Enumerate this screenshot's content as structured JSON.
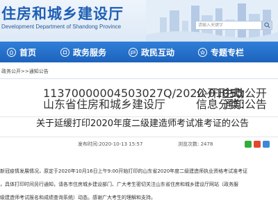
{
  "header": {
    "title_cn": "住房和城乡建设厅",
    "title_en": "Development Department of Shandong Province",
    "search_placeholder": "请输入关键字"
  },
  "nav": [
    {
      "label": "首页",
      "icon": "home-icon"
    },
    {
      "label": "政务服务",
      "icon": "service-icon"
    },
    {
      "label": "政民互动",
      "icon": "interaction-icon"
    },
    {
      "label": "专题专栏",
      "icon": "topic-icon"
    }
  ],
  "breadcrumb": "政务公开>>通知公告",
  "info": {
    "row1": {
      "value1": "11370000004503027Q/2020-01055",
      "label2": "公开形式:",
      "value2": "主动公开"
    },
    "row2": {
      "value1": "山东省住房和城乡建设厅",
      "label2": "信息分类:",
      "value2": "通知公告"
    }
  },
  "article": {
    "title": "关于延缓打印2020年度二级建造师考试准考证的公告",
    "date_line": "发布时间:2020-10-13 15:57",
    "views_label": "浏览次数:",
    "views": "2478",
    "paragraphs": [
      "新冠疫情发展情况，原定于2020年10月16日上午9:00开始打印的山东省2020年度二级建造师执业资格考试准考证",
      "，具体打印时间另行通知，请各市住房城乡建设部门、广大考生密切关注山东省住房和城乡建设厅网站（政务服",
      "级建造师考试报名和成绩查询系统）动态。感谢广大考生的理解和支持。"
    ]
  },
  "colors": {
    "nav": "#1d63bd",
    "title": "#1f5fb5"
  }
}
